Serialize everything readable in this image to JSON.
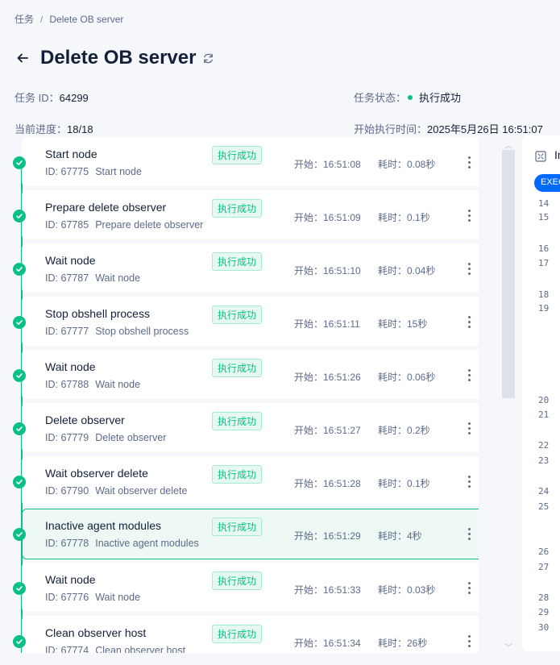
{
  "breadcrumb": {
    "parent": "任务",
    "separator": "/",
    "current": "Delete OB server"
  },
  "title": "Delete OB server",
  "meta": {
    "task_id_label": "任务 ID：",
    "task_id": "64299",
    "status_label": "任务状态：",
    "status": "执行成功",
    "progress_label": "当前进度：",
    "progress": "18/18",
    "start_label": "开始执行时间：",
    "start_time": "2025年5月26日 16:51:07"
  },
  "colors": {
    "success": "#0ac185",
    "brand": "#006aff"
  },
  "tasks": [
    {
      "name": "Start node",
      "id_label": "ID: 67775",
      "desc": "Start node",
      "status": "执行成功",
      "start": "开始：16:51:08",
      "duration": "耗时：0.08秒"
    },
    {
      "name": "Prepare delete observer",
      "id_label": "ID: 67785",
      "desc": "Prepare delete observer",
      "status": "执行成功",
      "start": "开始：16:51:09",
      "duration": "耗时：0.1秒"
    },
    {
      "name": "Wait node",
      "id_label": "ID: 67787",
      "desc": "Wait node",
      "status": "执行成功",
      "start": "开始：16:51:10",
      "duration": "耗时：0.04秒"
    },
    {
      "name": "Stop obshell process",
      "id_label": "ID: 67777",
      "desc": "Stop obshell process",
      "status": "执行成功",
      "start": "开始：16:51:11",
      "duration": "耗时：15秒"
    },
    {
      "name": "Wait node",
      "id_label": "ID: 67788",
      "desc": "Wait node",
      "status": "执行成功",
      "start": "开始：16:51:26",
      "duration": "耗时：0.06秒"
    },
    {
      "name": "Delete observer",
      "id_label": "ID: 67779",
      "desc": "Delete observer",
      "status": "执行成功",
      "start": "开始：16:51:27",
      "duration": "耗时：0.2秒"
    },
    {
      "name": "Wait observer delete",
      "id_label": "ID: 67790",
      "desc": "Wait observer delete",
      "status": "执行成功",
      "start": "开始：16:51:28",
      "duration": "耗时：0.1秒"
    },
    {
      "name": "Inactive agent modules",
      "id_label": "ID: 67778",
      "desc": "Inactive agent modules",
      "status": "执行成功",
      "start": "开始：16:51:29",
      "duration": "耗时：4秒"
    },
    {
      "name": "Wait node",
      "id_label": "ID: 67776",
      "desc": "Wait node",
      "status": "执行成功",
      "start": "开始：16:51:33",
      "duration": "耗时：0.03秒"
    },
    {
      "name": "Clean observer host",
      "id_label": "ID: 67774",
      "desc": "Clean observer host",
      "status": "执行成功",
      "start": "开始：16:51:34",
      "duration": "耗时：26秒"
    }
  ],
  "log_panel": {
    "title": "In",
    "tag": "EXEC",
    "line_numbers": [
      "14",
      "15",
      "16",
      "17",
      "18",
      "19",
      "20",
      "21",
      "22",
      "23",
      "24",
      "25",
      "26",
      "27",
      "28",
      "29",
      "30"
    ]
  }
}
